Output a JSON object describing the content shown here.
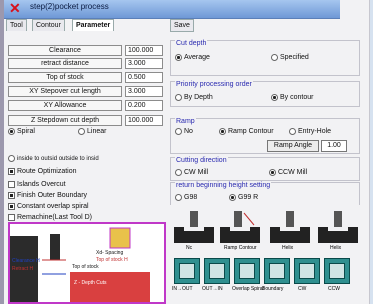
{
  "window": {
    "title": "step(2)pocket process"
  },
  "tabs": [
    {
      "label": "Tool"
    },
    {
      "label": "Contour"
    },
    {
      "label": "Parameter"
    }
  ],
  "save_label": "Save",
  "params": [
    {
      "label": "Clearance",
      "value": "100.000"
    },
    {
      "label": "retract distance",
      "value": "3.000"
    },
    {
      "label": "Top of stock",
      "value": "0.500"
    },
    {
      "label": "XY Stepover cut length",
      "value": "3.000"
    },
    {
      "label": "XY Allowance",
      "value": "0.200"
    },
    {
      "label": "Z Stepdown cut depth",
      "value": "100.000"
    }
  ],
  "pattern": {
    "options": [
      "Spiral",
      "Linear"
    ],
    "selected": "Spiral"
  },
  "inside_outside": "inside to outsid  outside to insid",
  "checks": [
    {
      "label": "Route Optimization",
      "checked": true
    },
    {
      "label": "Islands Overcut",
      "checked": false
    },
    {
      "label": "Finish Outer Boundary",
      "checked": true
    },
    {
      "label": "Constant overlap spiral",
      "checked": true
    },
    {
      "label": "Remachine(Last Tool D)",
      "checked": false
    }
  ],
  "cut_depth": {
    "title": "Cut depth",
    "options": [
      "Average",
      "Specified"
    ],
    "selected": "Average"
  },
  "priority": {
    "title": "Priority processing order",
    "options": [
      "By Depth",
      "By contour"
    ],
    "selected": "By contour"
  },
  "ramp": {
    "title": "Ramp",
    "options": [
      "No",
      "Ramp Contour",
      "Entry-Hole"
    ],
    "selected": "Ramp Contour",
    "angle_label": "Ramp Angle",
    "angle_value": "1.00"
  },
  "cutting_direction": {
    "title": "Cutting direction",
    "options": [
      "CW Mill",
      "CCW Mill"
    ],
    "selected": "CCW Mill"
  },
  "return_height": {
    "title": "return beginning height setting",
    "options": [
      "G98",
      "G99 R"
    ],
    "selected": "G99 R"
  },
  "diagram_labels": [
    "Clearance H",
    "Retract H",
    "Top of stock",
    "Z - Depth Cuts",
    "Xd- Spacing",
    "Top of stock H"
  ],
  "ramp_icons": [
    "Nc",
    "Ramp Contour",
    "Helix",
    "Helix"
  ],
  "bottom_icons": [
    "IN→OUT",
    "OUT→IN",
    "Overlap Spiral",
    "Boundary",
    "CW",
    "CCW"
  ]
}
